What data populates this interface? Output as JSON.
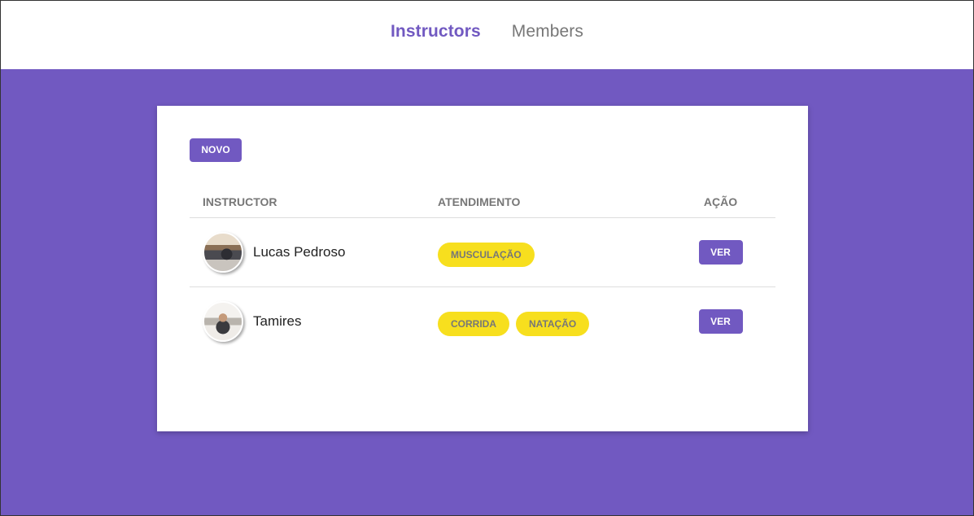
{
  "nav": {
    "items": [
      {
        "label": "Instructors",
        "active": true
      },
      {
        "label": "Members",
        "active": false
      }
    ]
  },
  "card": {
    "new_button": "Novo",
    "table": {
      "headers": {
        "instructor": "Instructor",
        "atendimento": "Atendimento",
        "acao": "Ação"
      },
      "rows": [
        {
          "name": "Lucas Pedroso",
          "services": [
            "Musculação"
          ],
          "action": "Ver"
        },
        {
          "name": "Tamires",
          "services": [
            "Corrida",
            "Natação"
          ],
          "action": "Ver"
        }
      ]
    }
  },
  "colors": {
    "brand": "#7159c1",
    "tag": "#f7df1e"
  }
}
